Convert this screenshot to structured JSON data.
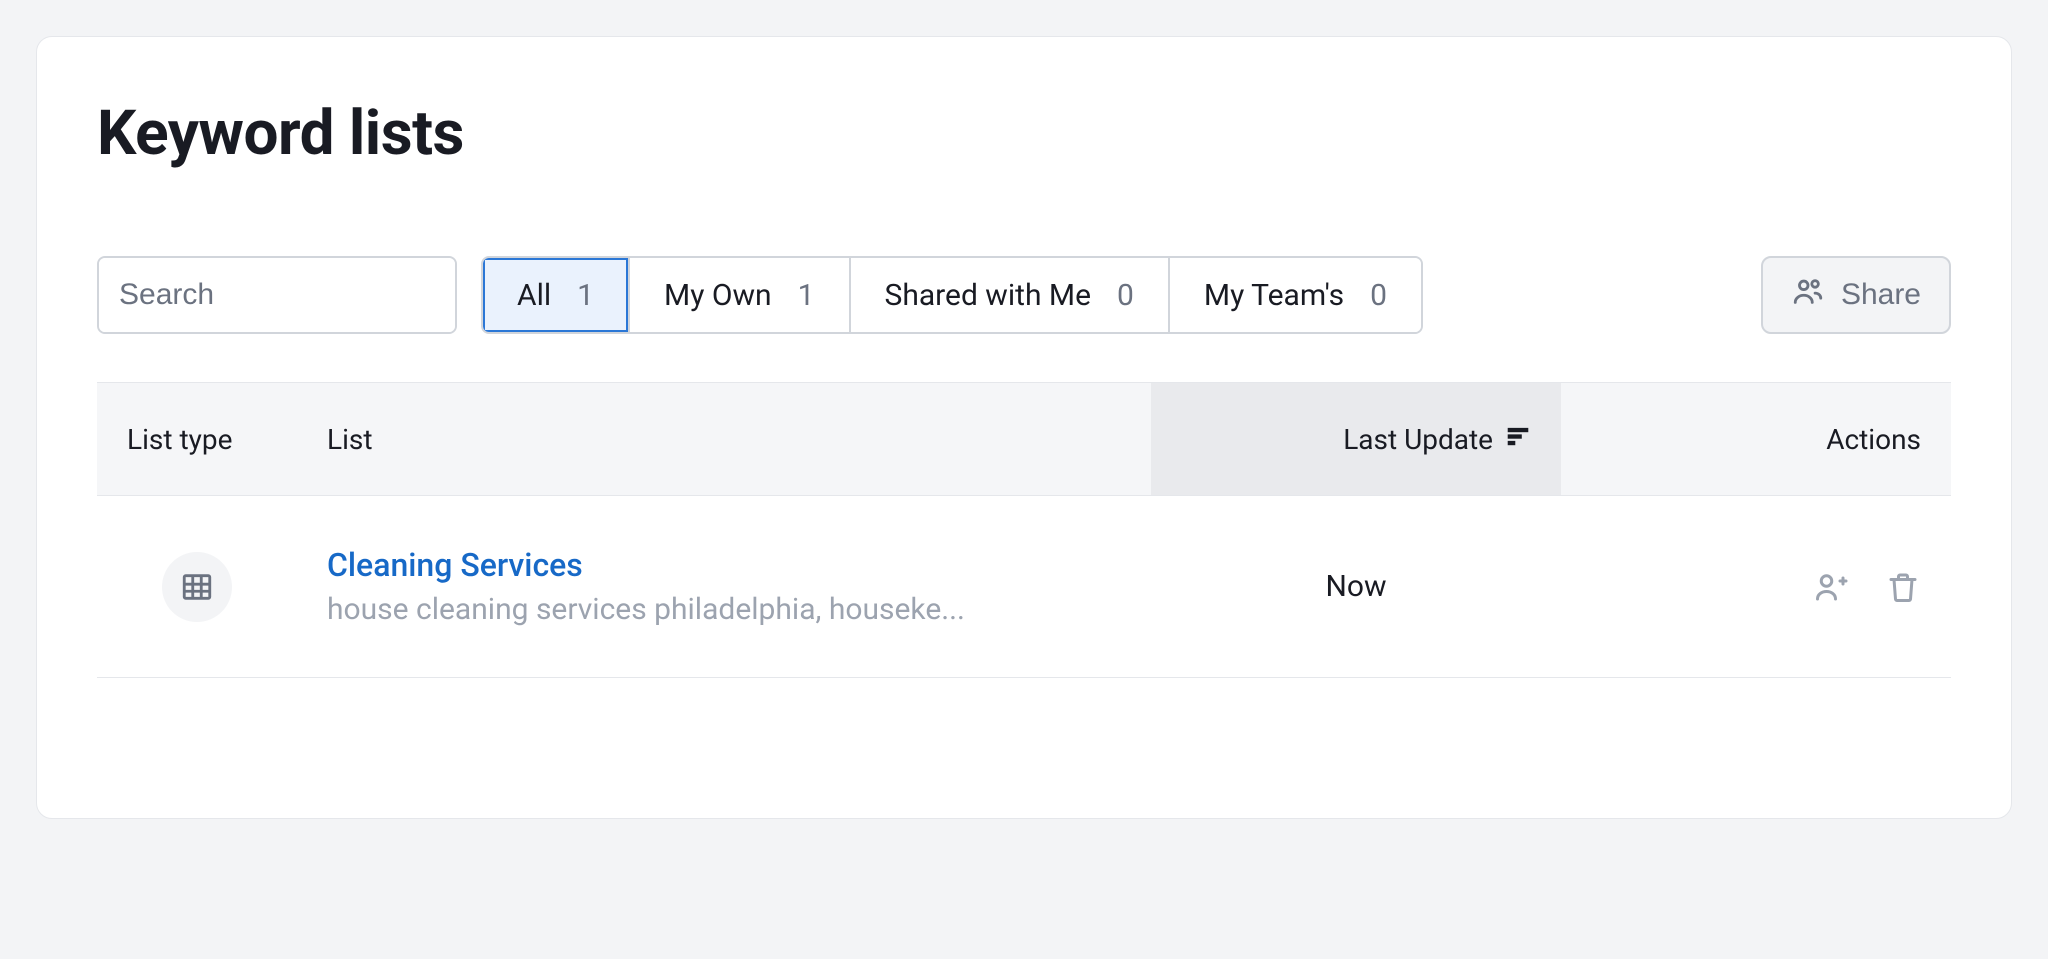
{
  "page": {
    "title": "Keyword lists"
  },
  "search": {
    "placeholder": "Search"
  },
  "tabs": [
    {
      "label": "All",
      "count": "1",
      "active": true
    },
    {
      "label": "My Own",
      "count": "1",
      "active": false
    },
    {
      "label": "Shared with Me",
      "count": "0",
      "active": false
    },
    {
      "label": "My Team's",
      "count": "0",
      "active": false
    }
  ],
  "share": {
    "label": "Share"
  },
  "columns": {
    "type": "List type",
    "list": "List",
    "update": "Last Update",
    "actions": "Actions"
  },
  "rows": [
    {
      "name": "Cleaning Services",
      "subtitle": "house cleaning services philadelphia, houseke...",
      "update": "Now"
    }
  ]
}
